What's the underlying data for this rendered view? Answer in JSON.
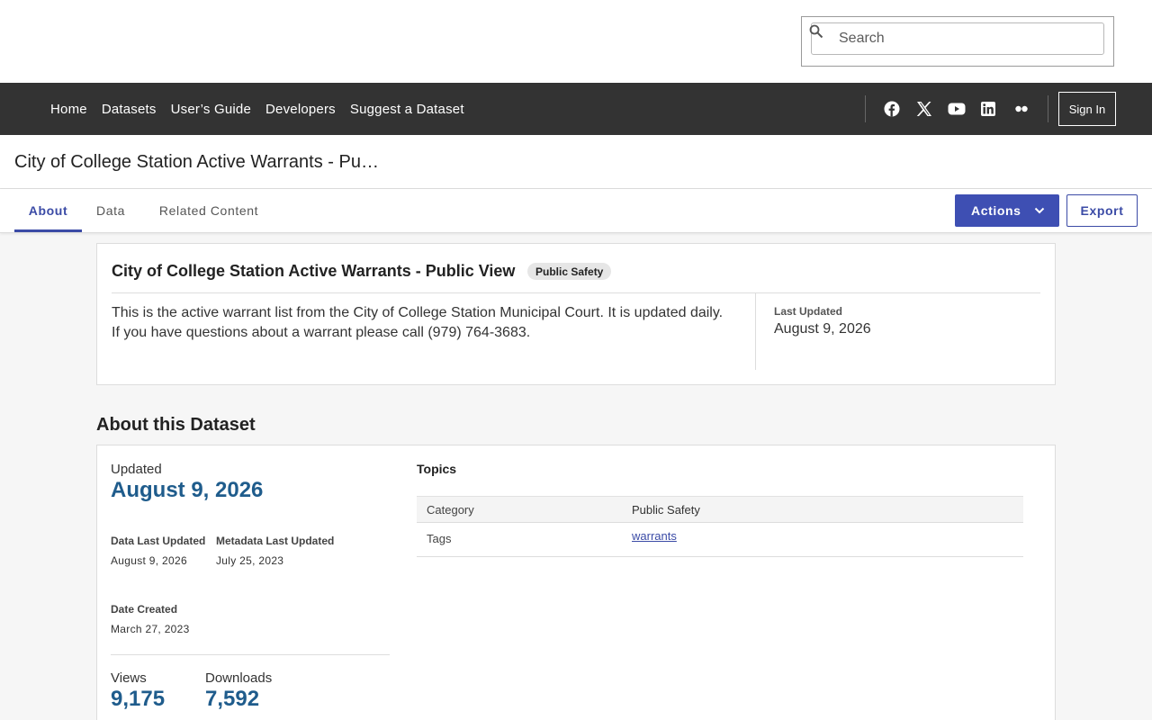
{
  "search": {
    "placeholder": "Search"
  },
  "nav": {
    "links": [
      "Home",
      "Datasets",
      "User’s Guide",
      "Developers",
      "Suggest a Dataset"
    ],
    "social_icons": [
      "facebook-icon",
      "x-icon",
      "youtube-icon",
      "linkedin-icon",
      "flickr-icon"
    ],
    "sign_in": "Sign In"
  },
  "title_bar": {
    "title": "City of College Station Active Warrants - Pu…"
  },
  "tabs": {
    "items": [
      "About",
      "Data",
      "Related Content"
    ],
    "active": "About",
    "actions_label": "Actions",
    "export_label": "Export"
  },
  "summary": {
    "title": "City of College Station Active Warrants - Public View",
    "badge": "Public Safety",
    "description": "This is the active warrant list from the City of College Station Municipal Court. It is updated daily. If you have questions about a warrant please call (979) 764-3683.",
    "last_updated_label": "Last Updated",
    "last_updated_value": "August 9, 2026"
  },
  "about": {
    "heading": "About this Dataset",
    "updated_label": "Updated",
    "updated_value": "August 9, 2026",
    "data_last_updated_label": "Data Last Updated",
    "data_last_updated_value": "August 9, 2026",
    "metadata_last_updated_label": "Metadata Last Updated",
    "metadata_last_updated_value": "July 25, 2023",
    "date_created_label": "Date Created",
    "date_created_value": "March 27, 2023",
    "views_label": "Views",
    "views_value": "9,175",
    "downloads_label": "Downloads",
    "downloads_value": "7,592",
    "topics_heading": "Topics",
    "topics_header": {
      "key": "Category",
      "value": "Public Safety"
    },
    "topics_rows": [
      {
        "key": "Tags",
        "value": "warrants"
      }
    ]
  },
  "colors": {
    "nav_background": "#333333",
    "accent": "#3e4fb3",
    "stat_value": "#1f5c8c"
  }
}
